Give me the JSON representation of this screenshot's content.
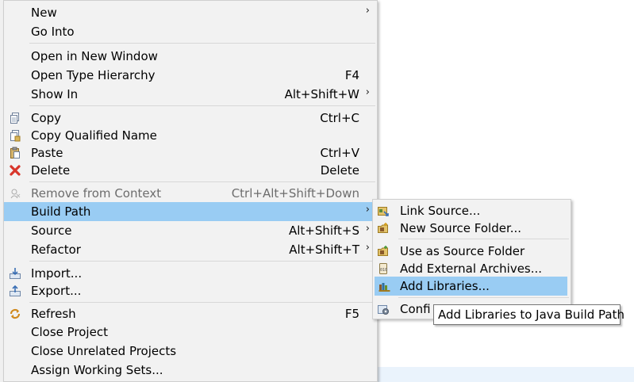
{
  "main_menu": {
    "items": [
      {
        "label": "New",
        "shortcut": "",
        "submenu": true,
        "icon": null
      },
      {
        "label": "Go Into",
        "shortcut": "",
        "submenu": false,
        "icon": null
      },
      {
        "label": "Open in New Window",
        "shortcut": "",
        "submenu": false,
        "icon": null
      },
      {
        "label": "Open Type Hierarchy",
        "shortcut": "F4",
        "submenu": false,
        "icon": null
      },
      {
        "label": "Show In",
        "shortcut": "Alt+Shift+W",
        "submenu": true,
        "icon": null
      },
      {
        "label": "Copy",
        "shortcut": "Ctrl+C",
        "submenu": false,
        "icon": "copy-icon"
      },
      {
        "label": "Copy Qualified Name",
        "shortcut": "",
        "submenu": false,
        "icon": "copy-qualified-name-icon"
      },
      {
        "label": "Paste",
        "shortcut": "Ctrl+V",
        "submenu": false,
        "icon": "paste-icon"
      },
      {
        "label": "Delete",
        "shortcut": "Delete",
        "submenu": false,
        "icon": "delete-icon"
      },
      {
        "label": "Remove from Context",
        "shortcut": "Ctrl+Alt+Shift+Down",
        "submenu": false,
        "icon": "remove-from-context-icon",
        "disabled": true
      },
      {
        "label": "Build Path",
        "shortcut": "",
        "submenu": true,
        "icon": null,
        "selected": true
      },
      {
        "label": "Source",
        "shortcut": "Alt+Shift+S",
        "submenu": true,
        "icon": null
      },
      {
        "label": "Refactor",
        "shortcut": "Alt+Shift+T",
        "submenu": true,
        "icon": null
      },
      {
        "label": "Import...",
        "shortcut": "",
        "submenu": false,
        "icon": "import-icon"
      },
      {
        "label": "Export...",
        "shortcut": "",
        "submenu": false,
        "icon": "export-icon"
      },
      {
        "label": "Refresh",
        "shortcut": "F5",
        "submenu": false,
        "icon": "refresh-icon"
      },
      {
        "label": "Close Project",
        "shortcut": "",
        "submenu": false,
        "icon": null
      },
      {
        "label": "Close Unrelated Projects",
        "shortcut": "",
        "submenu": false,
        "icon": null
      },
      {
        "label": "Assign Working Sets...",
        "shortcut": "",
        "submenu": false,
        "icon": null
      }
    ]
  },
  "build_path_submenu": {
    "items": [
      {
        "label": "Link Source...",
        "icon": "link-source-icon"
      },
      {
        "label": "New Source Folder...",
        "icon": "new-source-folder-icon"
      },
      {
        "label": "Use as Source Folder",
        "icon": "use-as-source-folder-icon"
      },
      {
        "label": "Add External Archives...",
        "icon": "add-external-archives-icon"
      },
      {
        "label": "Add Libraries...",
        "icon": "add-libraries-icon",
        "selected": true
      },
      {
        "label": "Configure Build Path...",
        "visible_text": "Confi",
        "icon": "configure-build-path-icon"
      }
    ]
  },
  "tooltip": {
    "text": "Add Libraries to Java Build Path"
  },
  "colors": {
    "menu_bg": "#f2f2f2",
    "selection": "#99ccf3",
    "disabled_text": "#6d6d6d"
  }
}
